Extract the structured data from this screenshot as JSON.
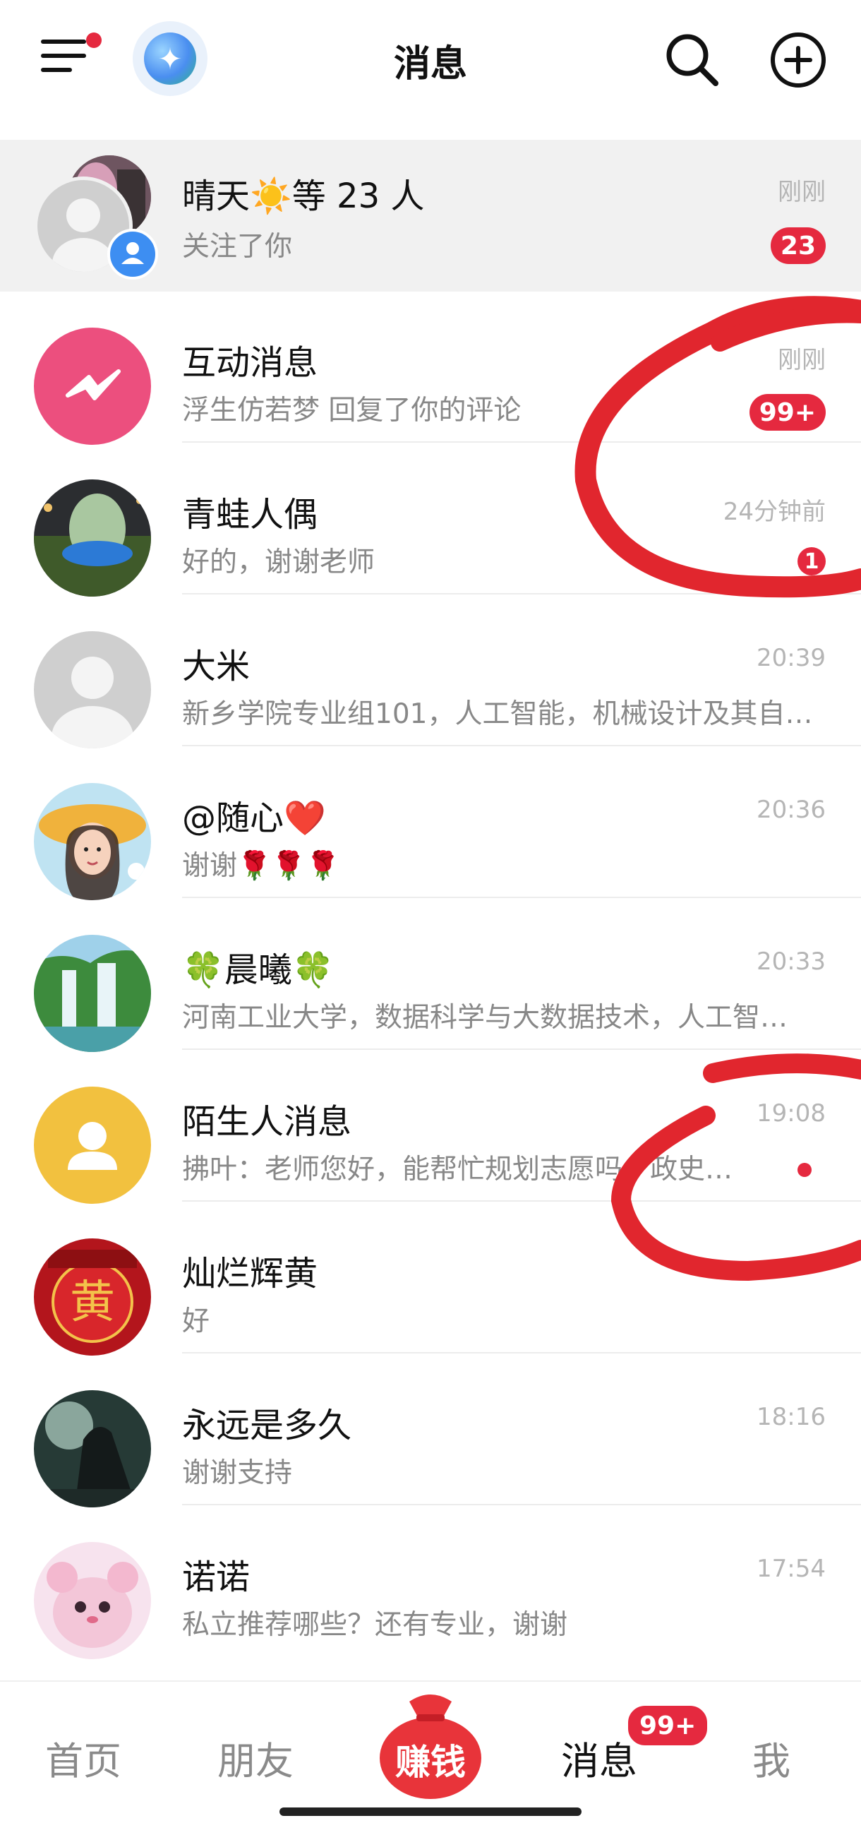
{
  "header": {
    "title": "消息",
    "menu_icon": "menu-icon",
    "assistant_icon": "ai-assistant-icon",
    "search_icon": "search-icon",
    "add_icon": "plus-circle-icon"
  },
  "messages": [
    {
      "name": "晴天☀️等 23 人",
      "preview": "关注了你",
      "time": "刚刚",
      "badge": "23"
    },
    {
      "name": "互动消息",
      "preview": "浮生仿若梦 回复了你的评论",
      "time": "刚刚",
      "badge": "99+"
    },
    {
      "name": "青蛙人偶",
      "preview": "好的，谢谢老师",
      "time": "24分钟前",
      "badge": "1"
    },
    {
      "name": "大米",
      "preview": "新乡学院专业组101，人工智能，机械设计及其自…",
      "time": "20:39"
    },
    {
      "name": "@随心❤️",
      "preview": "谢谢🌹🌹🌹",
      "time": "20:36"
    },
    {
      "name": "🍀晨曦🍀",
      "preview": "河南工业大学，数据科学与大数据技术，人工智…",
      "time": "20:33"
    },
    {
      "name": "陌生人消息",
      "preview": "拂叶：老师您好，能帮忙规划志愿吗，政史…",
      "time": "19:08"
    },
    {
      "name": "灿烂辉黄",
      "preview": "好",
      "time": ""
    },
    {
      "name": "永远是多久",
      "preview": "谢谢支持",
      "time": "18:16"
    },
    {
      "name": "诺诺",
      "preview": "私立推荐哪些？还有专业，谢谢",
      "time": "17:54"
    }
  ],
  "tabbar": {
    "home": "首页",
    "friends": "朋友",
    "earn": "赚钱",
    "messages": "消息",
    "messages_badge": "99+",
    "me": "我"
  },
  "colors": {
    "accent_red": "#e5293f",
    "interaction_pink": "#ec4f7e",
    "stranger_yellow": "#f2c13f",
    "annotation_red": "#e1262e"
  }
}
